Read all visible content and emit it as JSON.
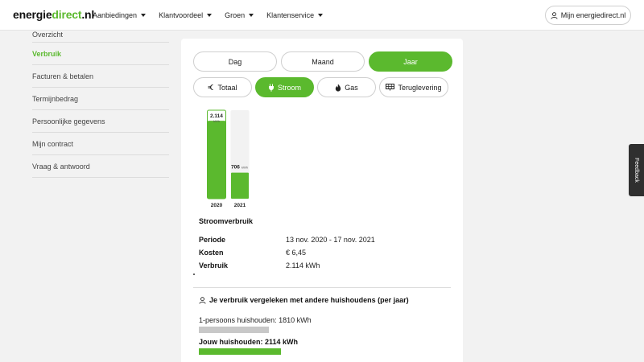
{
  "header": {
    "logo_part1": "energie",
    "logo_part2": "direct",
    "logo_part3": ".nl",
    "nav": [
      {
        "label": "Aanbiedingen"
      },
      {
        "label": "Klantvoordeel"
      },
      {
        "label": "Groen"
      },
      {
        "label": "Klantenservice"
      }
    ],
    "account_label": "Mijn energiedirect.nl"
  },
  "sidebar": {
    "items": [
      {
        "label": "Overzicht"
      },
      {
        "label": "Verbruik"
      },
      {
        "label": "Facturen & betalen"
      },
      {
        "label": "Termijnbedrag"
      },
      {
        "label": "Persoonlijke gegevens"
      },
      {
        "label": "Mijn contract"
      },
      {
        "label": "Vraag & antwoord"
      }
    ]
  },
  "period_tabs": [
    {
      "label": "Dag"
    },
    {
      "label": "Maand"
    },
    {
      "label": "Jaar"
    }
  ],
  "type_tabs": [
    {
      "label": "Totaal",
      "icon": "euro-icon"
    },
    {
      "label": "Stroom",
      "icon": "plug-icon"
    },
    {
      "label": "Gas",
      "icon": "flame-icon"
    },
    {
      "label": "Teruglevering",
      "icon": "solar-panel-icon"
    }
  ],
  "chart_data": {
    "type": "bar",
    "categories": [
      "2020",
      "2021"
    ],
    "values": [
      2114,
      706
    ],
    "data_labels": [
      "2.114",
      "706"
    ],
    "unit": "kWh",
    "ylim": [
      0,
      2400
    ],
    "highlighted": "2020",
    "grid": false
  },
  "details": {
    "title": "Stroomverbruik",
    "rows": [
      {
        "label": "Periode",
        "value": "13 nov. 2020 - 17 nov. 2021"
      },
      {
        "label": "Kosten",
        "value": "€ 6,45"
      },
      {
        "label": "Verbruik",
        "value": "2.114 kWh"
      }
    ]
  },
  "compare": {
    "title": "Je verbruik vergeleken met andere huishoudens (per jaar)",
    "rows": [
      {
        "label": "1-persoons huishouden: 1810 kWh",
        "value": 1810
      },
      {
        "label": "Jouw huishouden: 2114 kWh",
        "value": 2114
      }
    ]
  },
  "feedback_label": "Feedback",
  "colors": {
    "accent": "#5bb92e",
    "bar_bg": "#f2f2f2",
    "compare_grey": "#c8c8c8"
  }
}
